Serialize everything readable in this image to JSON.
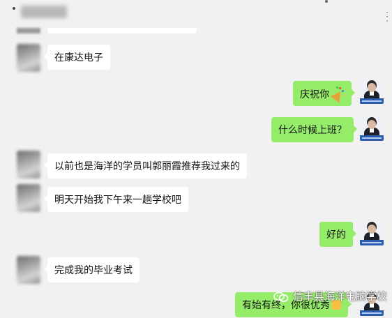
{
  "header": {
    "contact_name": "",
    "more_label": "···"
  },
  "messages": [
    {
      "side": "in",
      "text": "在康达电子"
    },
    {
      "side": "out",
      "text": "庆祝你",
      "emoji": "party-popper-icon"
    },
    {
      "side": "out",
      "text": "什么时候上班？"
    },
    {
      "side": "in",
      "text": "以前也是海洋的学员叫郭丽霞推荐我过来的"
    },
    {
      "side": "in",
      "text": "明天开始我下午来一趟学校吧"
    },
    {
      "side": "out",
      "text": "好的"
    },
    {
      "side": "in",
      "text": "完成我的毕业考试"
    },
    {
      "side": "out",
      "text": "有始有终，你很优秀",
      "emoji": "thumbs-up-icon"
    }
  ],
  "watermark": {
    "icon": "wechat-official-account-icon",
    "text": "信丰县海洋电脑学校"
  },
  "colors": {
    "background": "#f1f1f1",
    "incoming_bubble": "#ffffff",
    "outgoing_bubble": "#95ec69"
  }
}
